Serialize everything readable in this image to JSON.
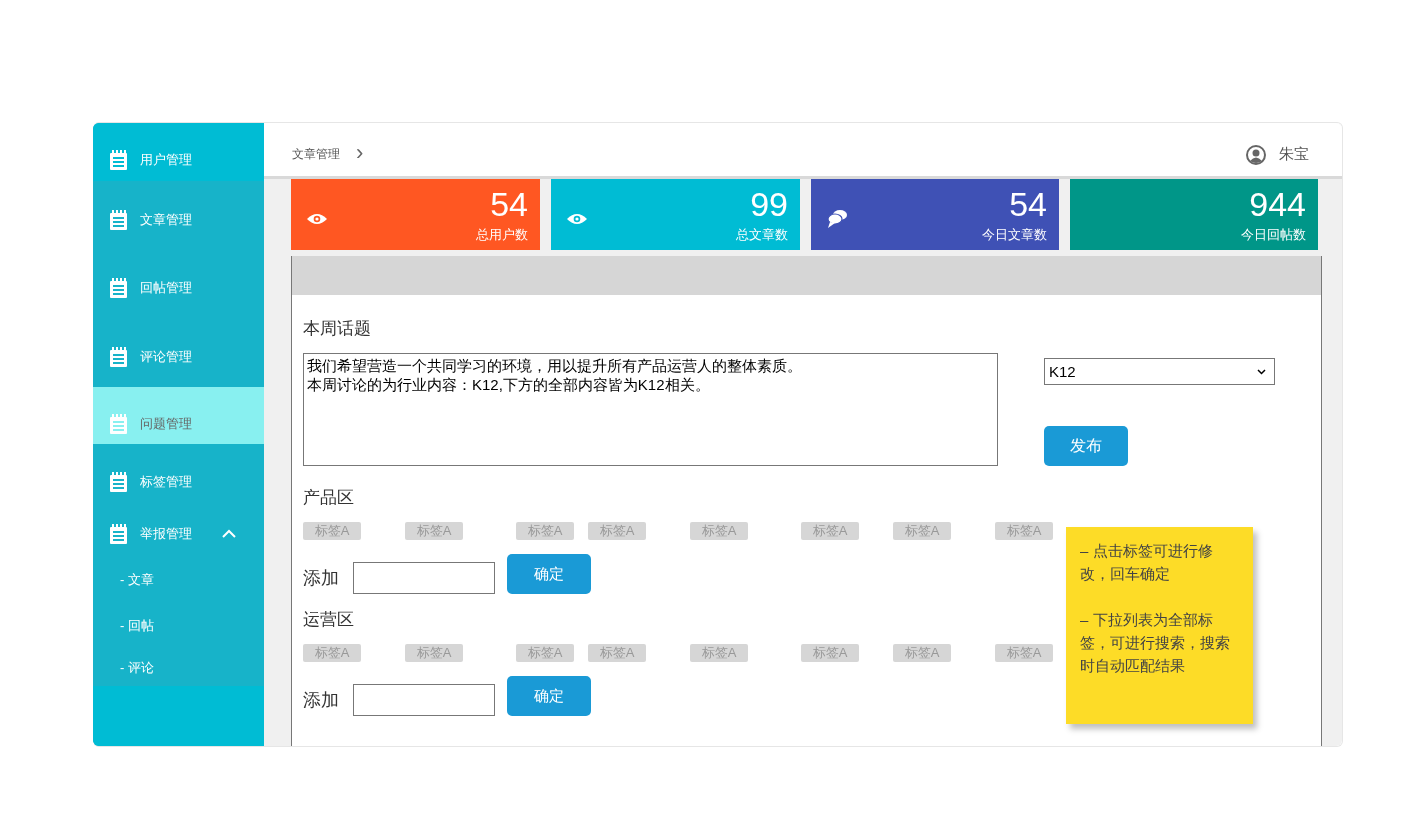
{
  "sidebar": {
    "items": [
      {
        "kind": "menu",
        "label": "用户管理",
        "selected": false,
        "highlight": true
      },
      {
        "kind": "menu",
        "label": "文章管理",
        "selected": false,
        "highlight": false
      },
      {
        "kind": "menu",
        "label": "回帖管理",
        "selected": false,
        "highlight": false
      },
      {
        "kind": "menu",
        "label": "评论管理",
        "selected": false,
        "highlight": false
      },
      {
        "kind": "menu",
        "label": "问题管理",
        "selected": true,
        "highlight": false
      },
      {
        "kind": "menu",
        "label": "标签管理",
        "selected": false,
        "highlight": false
      },
      {
        "kind": "group",
        "label": "举报管理",
        "selected": false,
        "highlight": false,
        "expanded": true,
        "children": [
          {
            "label": "- 文章",
            "selected": false
          },
          {
            "label": "- 回帖",
            "selected": false
          },
          {
            "label": "- 评论",
            "selected": false
          }
        ]
      }
    ]
  },
  "breadcrumb": {
    "label": "文章管理",
    "separator": "›"
  },
  "user": {
    "name": "朱宝"
  },
  "stats": [
    {
      "kind": "eye",
      "value": "54",
      "label": "总用户数",
      "color": "#ff5722"
    },
    {
      "kind": "eye",
      "value": "99",
      "label": "总文章数",
      "color": "#00bcd4"
    },
    {
      "kind": "chat",
      "value": "54",
      "label": "今日文章数",
      "color": "#3f51b5"
    },
    {
      "kind": "plain",
      "value": "944",
      "label": "今日回帖数",
      "color": "#009688"
    }
  ],
  "topic": {
    "title": "本周话题",
    "text_lines": [
      "我们希望营造一个共同学习的环境，用以提升所有产品运营人的整体素质。",
      "本周讨论的为行业内容：K12,下方的全部内容皆为K12相关。"
    ],
    "select_value": "K12",
    "publish_button": "发布"
  },
  "zones": [
    {
      "title": "产品区",
      "tags": [
        "标签A",
        "标签A",
        "标签A",
        "标签A",
        "标签A",
        "标签A",
        "标签A",
        "标签A"
      ],
      "add_label": "添加",
      "confirm_button": "确定"
    },
    {
      "title": "运营区",
      "tags": [
        "标签A",
        "标签A",
        "标签A",
        "标签A",
        "标签A",
        "标签A",
        "标签A",
        "标签A"
      ],
      "add_label": "添加",
      "confirm_button": "确定"
    }
  ],
  "note": {
    "paragraphs": [
      "– 点击标签可进行修改，回车确定",
      "– 下拉列表为全部标签，可进行搜索，搜索时自动匹配结果"
    ]
  }
}
